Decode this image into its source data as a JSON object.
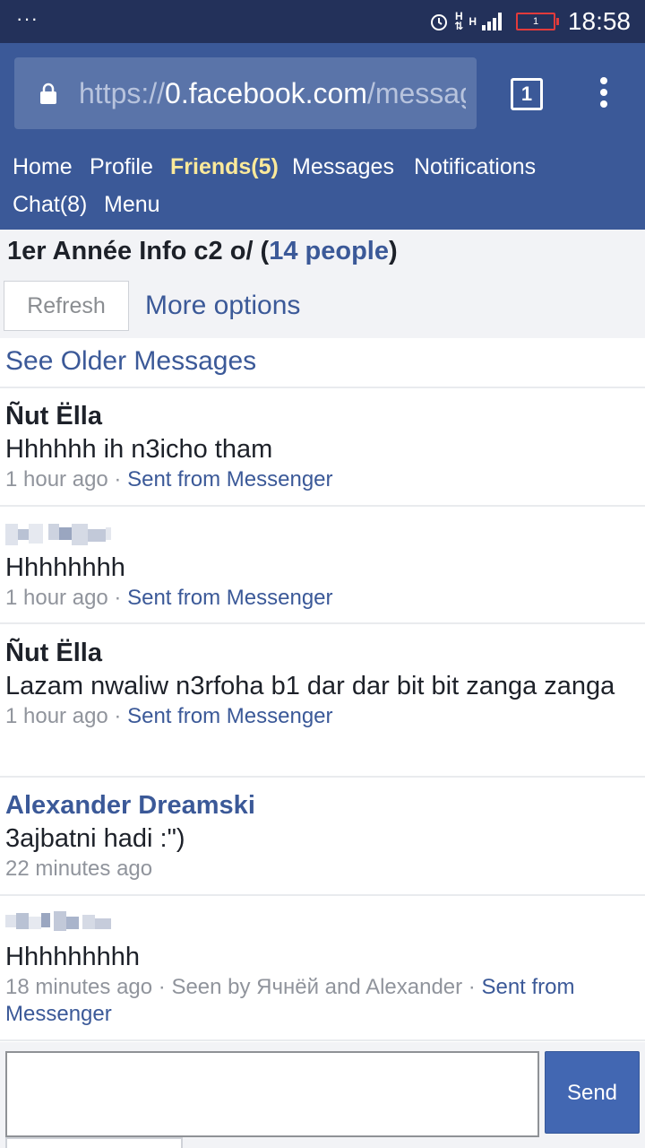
{
  "status_bar": {
    "time": "18:58",
    "battery": "1",
    "network": "H"
  },
  "browser": {
    "url_scheme": "https://",
    "url_host": "0.facebook.com",
    "url_path": "/messages",
    "tab_count": "1"
  },
  "nav": {
    "items": [
      "Home",
      "Profile",
      "Friends(5)",
      "Messages",
      "Notifications",
      "Chat(8)",
      "Menu"
    ]
  },
  "thread": {
    "title": "1er Année Info c2 o/",
    "people_prefix": " (",
    "people": "14 people",
    "people_suffix": ")",
    "refresh_label": "Refresh",
    "more_options_label": "More options",
    "see_older_label": "See Older Messages"
  },
  "messages": [
    {
      "sender": "Ñut Ëlla",
      "body": "Hhhhhh ih n3icho tham",
      "time": "1 hour ago",
      "sep": " · ",
      "source": "Sent from Messenger"
    },
    {
      "sender": "",
      "body": "Hhhhhhhh",
      "time": "1 hour ago",
      "sep": " · ",
      "source": "Sent from Messenger"
    },
    {
      "sender": "Ñut Ëlla",
      "body": "Lazam nwaliw n3rfoha b1 dar dar bit bit zanga zanga",
      "time": "1 hour ago",
      "sep": " · ",
      "source": "Sent from Messenger"
    },
    {
      "sender": "Alexander Dreamski",
      "body": "3ajbatni hadi :\")",
      "time": "22 minutes ago"
    },
    {
      "sender": "",
      "body": "Hhhhhhhhh",
      "time": "18 minutes ago",
      "seen": " · Seen by Ячнёй and Alexander · ",
      "source": "Sent from Messenger"
    }
  ],
  "composer": {
    "send_label": "Send"
  },
  "colors": {
    "facebook_blue": "#3b5998",
    "status_bar": "#23315a",
    "active_nav": "#fbe99a"
  }
}
